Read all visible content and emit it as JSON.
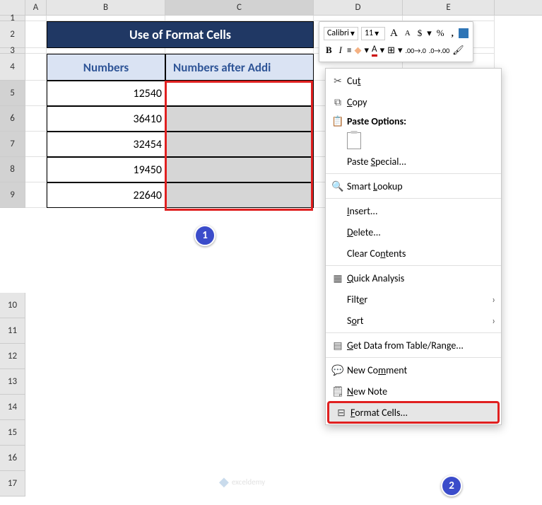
{
  "columns": [
    "A",
    "B",
    "C",
    "D",
    "E"
  ],
  "rows_top": [
    "1",
    "2",
    "3",
    "4",
    "5",
    "6",
    "7",
    "8",
    "9"
  ],
  "rows_bottom": [
    "10",
    "11",
    "12",
    "13",
    "14",
    "15",
    "16",
    "17"
  ],
  "title": "Use of Format Cells",
  "headers": {
    "b": "Numbers",
    "c": "Numbers after Addi"
  },
  "data": {
    "b5": "12540",
    "b6": "36410",
    "b7": "32454",
    "b8": "19450",
    "b9": "22640"
  },
  "badges": {
    "one": "1",
    "two": "2"
  },
  "toolbar": {
    "font": "Calibri",
    "size": "11",
    "inc": "A",
    "dec": "A",
    "currency": "$",
    "percent": "%",
    "comma": ",",
    "bold": "B",
    "italic": "I"
  },
  "menu": {
    "cut": "Cut",
    "copy": "Copy",
    "paste_options": "Paste Options:",
    "paste_special": "Paste Special...",
    "smart_lookup": "Smart Lookup",
    "insert": "Insert...",
    "delete": "Delete...",
    "clear": "Clear Contents",
    "quick_analysis": "Quick Analysis",
    "filter": "Filter",
    "sort": "Sort",
    "get_data": "Get Data from Table/Range...",
    "new_comment": "New Comment",
    "new_note": "New Note",
    "format_cells": "Format Cells..."
  },
  "watermark": "exceldemy"
}
